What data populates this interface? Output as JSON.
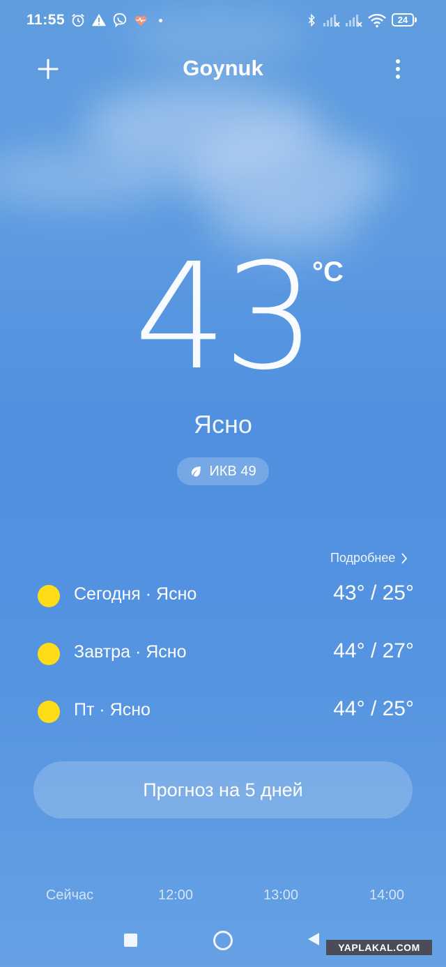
{
  "status_bar": {
    "time": "11:55",
    "battery": "24"
  },
  "header": {
    "city": "Goynuk"
  },
  "current": {
    "temperature": "43",
    "unit": "°C",
    "condition": "Ясно",
    "aqi": "ИКВ 49"
  },
  "forecast": {
    "details_label": "Подробнее",
    "days": [
      {
        "label": "Сегодня · Ясно",
        "range": "43° / 25°"
      },
      {
        "label": "Завтра · Ясно",
        "range": "44° / 27°"
      },
      {
        "label": "Пт · Ясно",
        "range": "44° / 25°"
      }
    ],
    "five_day_button": "Прогноз на 5 дней"
  },
  "hourly": {
    "labels": [
      "Сейчас",
      "12:00",
      "13:00",
      "14:00"
    ]
  },
  "watermark": "YAPLAKAL.COM",
  "colors": {
    "sun": "#ffdc18",
    "sky_top": "#5f9ddf",
    "sky_bottom": "#66a1e4"
  }
}
